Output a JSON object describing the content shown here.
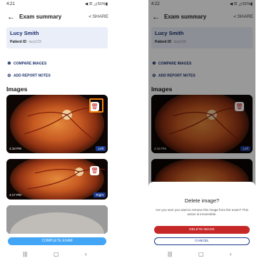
{
  "screen1": {
    "status": {
      "time": "4:21",
      "icons": "◀ ☰ ◿ 51%▮"
    },
    "header": {
      "title": "Exam summary",
      "share": "SHARE"
    },
    "patient": {
      "name": "Lucy Smith",
      "id_label": "Patient ID",
      "id_value": "lucy123"
    },
    "actions": {
      "compare": "COMPARE IMAGES",
      "notes": "ADD REPORT NOTES"
    },
    "section_title": "Images",
    "images": [
      {
        "time": "4:18 PM",
        "eye": "Left"
      },
      {
        "time": "4:17 PM",
        "eye": "Right"
      }
    ],
    "complete_button": "COMPLETE EXAM"
  },
  "screen2": {
    "status": {
      "time": "4:22",
      "icons": "◀ ☰ ◿ 51%▮"
    },
    "header": {
      "title": "Exam summary",
      "share": "SHARE"
    },
    "patient": {
      "name": "Lucy Smith",
      "id_label": "Patient ID",
      "id_value": "lucy123"
    },
    "actions": {
      "compare": "COMPARE IMAGES",
      "notes": "ADD REPORT NOTES"
    },
    "section_title": "Images",
    "images": [
      {
        "time": "4:18 PM",
        "eye": "Left"
      }
    ],
    "dialog": {
      "title": "Delete image?",
      "message": "Are you sure you want to remove this image from the exam? This action is irreversible.",
      "delete_button": "DELETE IMAGE",
      "cancel_button": "CANCEL"
    }
  },
  "icons": {
    "back": "arrow-left-icon",
    "share": "share-icon",
    "compare": "compare-icon",
    "notes": "add-circle-icon",
    "trash": "trash-icon",
    "nav_recent": "recent-apps-icon",
    "nav_home": "home-icon",
    "nav_back": "back-chevron-icon"
  },
  "colors": {
    "accent": "#1b3a8f",
    "danger": "#c62828",
    "primary_button": "#42a5f5",
    "highlight": "#f0830f"
  }
}
